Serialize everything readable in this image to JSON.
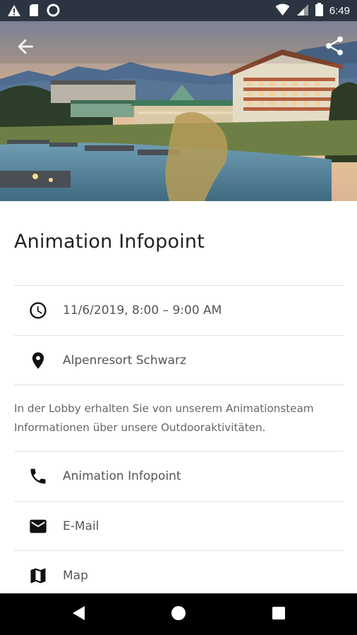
{
  "status_bar": {
    "time": "6:49",
    "left_icons": [
      "warning-icon",
      "sd-card-icon",
      "sync-circle-icon"
    ],
    "right_icons": [
      "wifi-icon",
      "cell-signal-icon",
      "battery-icon"
    ]
  },
  "header": {
    "back_icon": "arrow-back-icon",
    "share_icon": "share-icon",
    "image_alt": "Alpenresort Schwarz"
  },
  "event": {
    "title": "Animation Infopoint",
    "datetime": "11/6/2019, 8:00 – 9:00 AM",
    "location": "Alpenresort Schwarz",
    "description": "In der Lobby erhalten Sie von unserem Animationsteam Informationen über unsere Outdooraktivitäten."
  },
  "actions": [
    {
      "icon": "phone-icon",
      "label": "Animation Infopoint"
    },
    {
      "icon": "email-icon",
      "label": "E-Mail"
    },
    {
      "icon": "map-icon",
      "label": "Map"
    }
  ],
  "nav_bar": {
    "buttons": [
      "back-triangle-icon",
      "home-circle-icon",
      "recents-square-icon"
    ]
  },
  "colors": {
    "status_bar": "#2b3440",
    "text_primary": "#222222",
    "text_secondary": "#555555",
    "divider": "#e2e2e2"
  }
}
